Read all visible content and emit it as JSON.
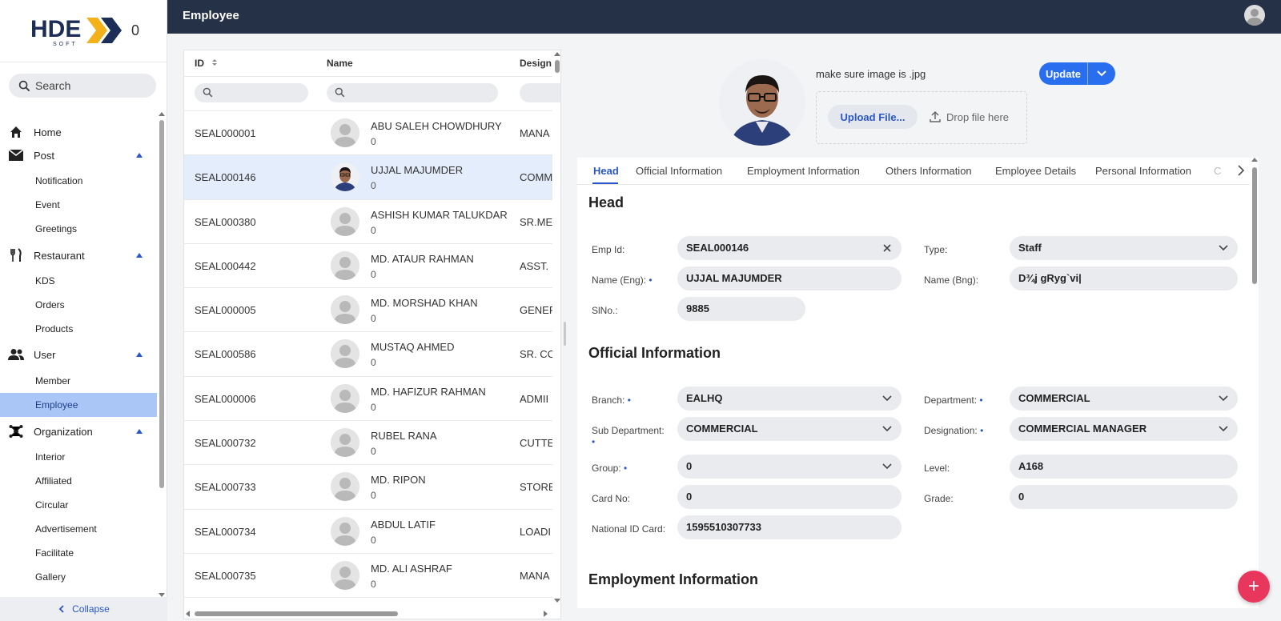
{
  "sidebar": {
    "logo_count": "0",
    "search_placeholder": "Search",
    "items": [
      {
        "label": "Home"
      },
      {
        "label": "Post"
      },
      {
        "label": "Notification"
      },
      {
        "label": "Event"
      },
      {
        "label": "Greetings"
      },
      {
        "label": "Restaurant"
      },
      {
        "label": "KDS"
      },
      {
        "label": "Orders"
      },
      {
        "label": "Products"
      },
      {
        "label": "User"
      },
      {
        "label": "Member"
      },
      {
        "label": "Employee"
      },
      {
        "label": "Organization"
      },
      {
        "label": "Interior"
      },
      {
        "label": "Affiliated"
      },
      {
        "label": "Circular"
      },
      {
        "label": "Advertisement"
      },
      {
        "label": "Facilitate"
      },
      {
        "label": "Gallery"
      }
    ],
    "collapse_label": "Collapse"
  },
  "header": {
    "title": "Employee"
  },
  "table": {
    "columns": [
      {
        "label": "ID"
      },
      {
        "label": "Name"
      },
      {
        "label": "Design"
      }
    ],
    "rows": [
      {
        "id": "SEAL000001",
        "name": "ABU SALEH CHOWDHURY",
        "code": "0",
        "designation": "MANA"
      },
      {
        "id": "SEAL000146",
        "name": "UJJAL MAJUMDER",
        "code": "0",
        "designation": "COMM"
      },
      {
        "id": "SEAL000380",
        "name": "ASHISH KUMAR TALUKDAR",
        "code": "0",
        "designation": "SR.ME"
      },
      {
        "id": "SEAL000442",
        "name": "MD. ATAUR RAHMAN",
        "code": "0",
        "designation": "ASST."
      },
      {
        "id": "SEAL000005",
        "name": "MD. MORSHAD KHAN",
        "code": "0",
        "designation": "GENEF"
      },
      {
        "id": "SEAL000586",
        "name": "MUSTAQ AHMED",
        "code": "0",
        "designation": "SR. CC"
      },
      {
        "id": "SEAL000006",
        "name": "MD. HAFIZUR RAHMAN",
        "code": "0",
        "designation": "ADMII"
      },
      {
        "id": "SEAL000732",
        "name": "RUBEL RANA",
        "code": "0",
        "designation": "CUTTE"
      },
      {
        "id": "SEAL000733",
        "name": "MD. RIPON",
        "code": "0",
        "designation": "STORE"
      },
      {
        "id": "SEAL000734",
        "name": "ABDUL LATIF",
        "code": "0",
        "designation": "LOADI"
      },
      {
        "id": "SEAL000735",
        "name": "MD. ALI ASHRAF",
        "code": "0",
        "designation": "MANA"
      }
    ]
  },
  "detail": {
    "image_hint": "make sure image is .jpg",
    "upload_label": "Upload File...",
    "drop_label": "Drop file here",
    "update_label": "Update",
    "tabs": [
      {
        "label": "Head"
      },
      {
        "label": "Official Information"
      },
      {
        "label": "Employment Information"
      },
      {
        "label": "Others Information"
      },
      {
        "label": "Employee Details"
      },
      {
        "label": "Personal Information"
      }
    ],
    "tab_more": "C",
    "head": {
      "title": "Head",
      "emp_id_label": "Emp Id:",
      "emp_id": "SEAL000146",
      "type_label": "Type:",
      "type": "Staff",
      "name_eng_label": "Name (Eng):",
      "name_eng": "UJJAL MAJUMDER",
      "name_bng_label": "Name (Bng):",
      "name_bng": "D¾j gRyg`vi|",
      "slno_label": "SlNo.:",
      "slno": "9885"
    },
    "official": {
      "title": "Official Information",
      "branch_label": "Branch:",
      "branch": "EALHQ",
      "department_label": "Department:",
      "department": "COMMERCIAL",
      "sub_department_label": "Sub Department:",
      "sub_department": "COMMERCIAL",
      "designation_label": "Designation:",
      "designation": "COMMERCIAL MANAGER",
      "group_label": "Group:",
      "group": "0",
      "level_label": "Level:",
      "level": "A168",
      "card_no_label": "Card No:",
      "card_no": "0",
      "grade_label": "Grade:",
      "grade": "0",
      "nid_label": "National ID Card:",
      "nid": "1595510307733"
    },
    "employment": {
      "title": "Employment Information"
    },
    "required_mark": "•"
  },
  "fab_label": "+",
  "colors": {
    "header_bg": "#243146",
    "accent": "#2a57c8",
    "button_primary": "#2a6ef0",
    "active_nav": "#a9c6f7",
    "selected_row": "#e4edfc",
    "fab": "#e8365d"
  }
}
